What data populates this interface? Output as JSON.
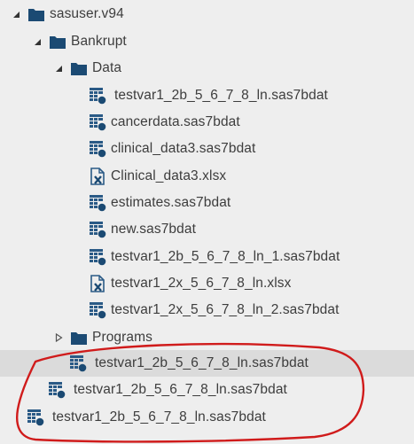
{
  "tree": {
    "root": {
      "label": "sasuser.v94",
      "icon": "library-icon",
      "expanded": true
    },
    "bankrupt": {
      "label": "Bankrupt",
      "icon": "library-icon",
      "expanded": true
    },
    "data_folder": {
      "label": "Data",
      "icon": "folder-icon",
      "expanded": true
    },
    "data_items": [
      {
        "label": "testvar1_2b_5_6_7_8_ln.sas7bdat",
        "icon": "sas-dataset-icon"
      },
      {
        "label": "cancerdata.sas7bdat",
        "icon": "sas-dataset-icon"
      },
      {
        "label": "clinical_data3.sas7bdat",
        "icon": "sas-dataset-icon"
      },
      {
        "label": "Clinical_data3.xlsx",
        "icon": "excel-file-icon"
      },
      {
        "label": "estimates.sas7bdat",
        "icon": "sas-dataset-icon"
      },
      {
        "label": "new.sas7bdat",
        "icon": "sas-dataset-icon"
      },
      {
        "label": "testvar1_2b_5_6_7_8_ln_1.sas7bdat",
        "icon": "sas-dataset-icon"
      },
      {
        "label": "testvar1_2x_5_6_7_8_ln.xlsx",
        "icon": "excel-file-icon"
      },
      {
        "label": "testvar1_2x_5_6_7_8_ln_2.sas7bdat",
        "icon": "sas-dataset-icon"
      }
    ],
    "programs_folder": {
      "label": "Programs",
      "icon": "folder-icon",
      "expanded": false
    },
    "extra_items": [
      {
        "label": "testvar1_2b_5_6_7_8_ln.sas7bdat",
        "icon": "sas-dataset-icon",
        "selected": true
      },
      {
        "label": "testvar1_2b_5_6_7_8_ln.sas7bdat",
        "icon": "sas-dataset-icon",
        "selected": false
      },
      {
        "label": "testvar1_2b_5_6_7_8_ln.sas7bdat",
        "icon": "sas-dataset-icon",
        "selected": false
      }
    ]
  },
  "colors": {
    "background": "#eeeeee",
    "selected_row": "#dbdbdb",
    "folder": "#1b4a73",
    "dataset": "#2a5a86",
    "annotation": "#d01b1b",
    "text": "#3d3d3d"
  }
}
